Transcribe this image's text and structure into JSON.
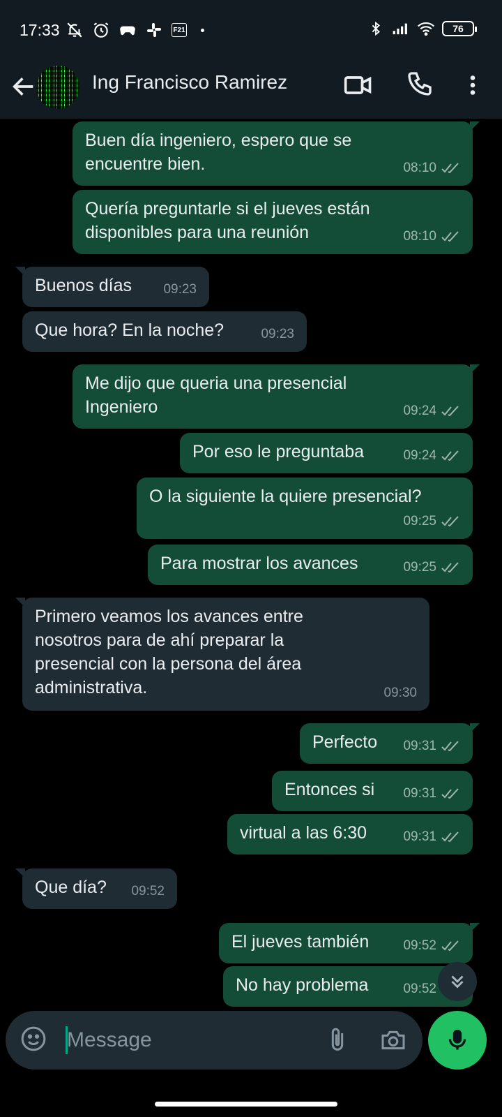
{
  "status_bar": {
    "time": "17:33",
    "battery": "76",
    "notification_icons": [
      "muted-bell-icon",
      "alarm-icon",
      "game-icon",
      "slack-icon",
      "f21-icon"
    ],
    "f21_label": "F21",
    "right_icons": [
      "bluetooth-icon",
      "signal-icon",
      "wifi-icon",
      "battery-icon"
    ]
  },
  "header": {
    "contact_name": "Ing Francisco Ramirez"
  },
  "messages": [
    {
      "dir": "out",
      "text": "Buen día ingeniero, espero que se\nencuentre bien.",
      "time": "08:10",
      "status": "read"
    },
    {
      "dir": "out",
      "text": "Quería preguntarle si el jueves están\ndisponibles para una reunión",
      "time": "08:10",
      "status": "read"
    },
    {
      "dir": "in",
      "text": "Buenos días",
      "time": "09:23"
    },
    {
      "dir": "in",
      "text": "Que hora? En la noche?",
      "time": "09:23"
    },
    {
      "dir": "out",
      "text": "Me dijo que queria una presencial\nIngeniero",
      "time": "09:24",
      "status": "read"
    },
    {
      "dir": "out",
      "text": "Por eso le preguntaba",
      "time": "09:24",
      "status": "read"
    },
    {
      "dir": "out",
      "text": "O la siguiente la quiere presencial?",
      "time": "09:25",
      "status": "read"
    },
    {
      "dir": "out",
      "text": "Para mostrar los avances",
      "time": "09:25",
      "status": "read"
    },
    {
      "dir": "in",
      "text": "Primero veamos los avances entre\nnosotros para de ahí preparar la\npresencial con la persona del área\nadministrativa.",
      "time": "09:30"
    },
    {
      "dir": "out",
      "text": "Perfecto",
      "time": "09:31",
      "status": "read"
    },
    {
      "dir": "out",
      "text": "Entonces si",
      "time": "09:31",
      "status": "read"
    },
    {
      "dir": "out",
      "text": "virtual a las 6:30",
      "time": "09:31",
      "status": "read"
    },
    {
      "dir": "in",
      "text": "Que día?",
      "time": "09:52"
    },
    {
      "dir": "out",
      "text": "El jueves también",
      "time": "09:52",
      "status": "read"
    },
    {
      "dir": "out",
      "text": "No hay problema",
      "time": "09:52",
      "status": "read"
    }
  ],
  "composer": {
    "placeholder": "Message"
  },
  "colors": {
    "header_bg": "#111b21",
    "outgoing_bubble": "#144d37",
    "incoming_bubble": "#202c33",
    "accent_green": "#21c063",
    "read_ticks": "#9fb8ad"
  }
}
